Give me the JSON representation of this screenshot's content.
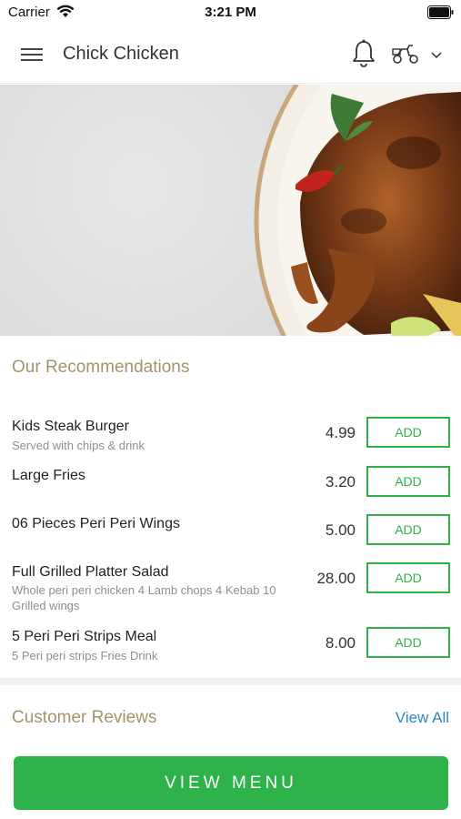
{
  "status_bar": {
    "carrier": "Carrier",
    "time": "3:21 PM"
  },
  "header": {
    "title": "Chick Chicken",
    "icons": [
      "hamburger-menu-icon",
      "bell-icon",
      "scooter-icon",
      "chevron-down-icon"
    ]
  },
  "hero": {
    "image": "grilled peri peri chicken on plate with chilli, parsley and fries"
  },
  "recommendations": {
    "title": "Our Recommendations",
    "items": [
      {
        "name": "Kids Steak Burger",
        "desc": "Served with chips & drink",
        "price": "4.99",
        "add_label": "ADD"
      },
      {
        "name": "Large Fries",
        "desc": "",
        "price": "3.20",
        "add_label": "ADD"
      },
      {
        "name": "06 Pieces Peri Peri Wings",
        "desc": "",
        "price": "5.00",
        "add_label": "ADD"
      },
      {
        "name": "Full Grilled Platter Salad",
        "desc": "Whole peri peri chicken  4 Lamb chops  4 Kebab 10 Grilled wings",
        "price": "28.00",
        "add_label": "ADD"
      },
      {
        "name": "5 Peri Peri Strips Meal",
        "desc": "5 Peri peri strips  Fries  Drink",
        "price": "8.00",
        "add_label": "ADD"
      }
    ]
  },
  "reviews": {
    "title": "Customer Reviews",
    "view_all": "View All"
  },
  "footer": {
    "view_menu": "VIEW MENU"
  },
  "colors": {
    "accent_green": "#2db34a",
    "section_title": "#a0966b",
    "link_blue": "#2f86c4"
  }
}
